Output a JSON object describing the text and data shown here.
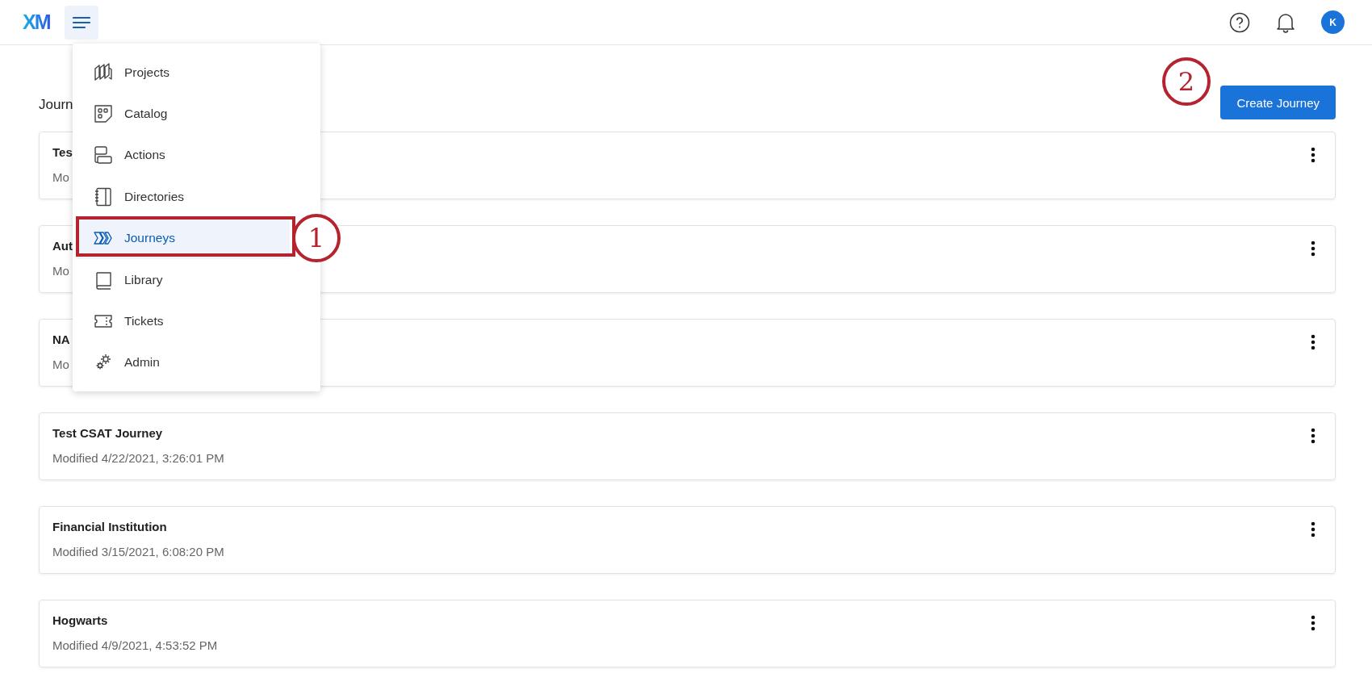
{
  "header": {
    "logo": "XM",
    "avatar": "K"
  },
  "menu": {
    "items": [
      {
        "label": "Projects",
        "selected": false
      },
      {
        "label": "Catalog",
        "selected": false
      },
      {
        "label": "Actions",
        "selected": false
      },
      {
        "label": "Directories",
        "selected": false
      },
      {
        "label": "Journeys",
        "selected": true
      },
      {
        "label": "Library",
        "selected": false
      },
      {
        "label": "Tickets",
        "selected": false
      },
      {
        "label": "Admin",
        "selected": false
      }
    ]
  },
  "page": {
    "title": "Journ",
    "create_button": "Create Journey"
  },
  "journeys": [
    {
      "name": "Tes",
      "modified": "Mo"
    },
    {
      "name": "Aut",
      "modified": "Mo"
    },
    {
      "name": "NA",
      "modified": "Mo"
    },
    {
      "name": "Test CSAT Journey",
      "modified": "Modified 4/22/2021, 3:26:01 PM"
    },
    {
      "name": "Financial Institution",
      "modified": "Modified 3/15/2021, 6:08:20 PM"
    },
    {
      "name": "Hogwarts",
      "modified": "Modified 4/9/2021, 4:53:52 PM"
    }
  ],
  "callouts": [
    {
      "number": "1"
    },
    {
      "number": "2"
    }
  ]
}
